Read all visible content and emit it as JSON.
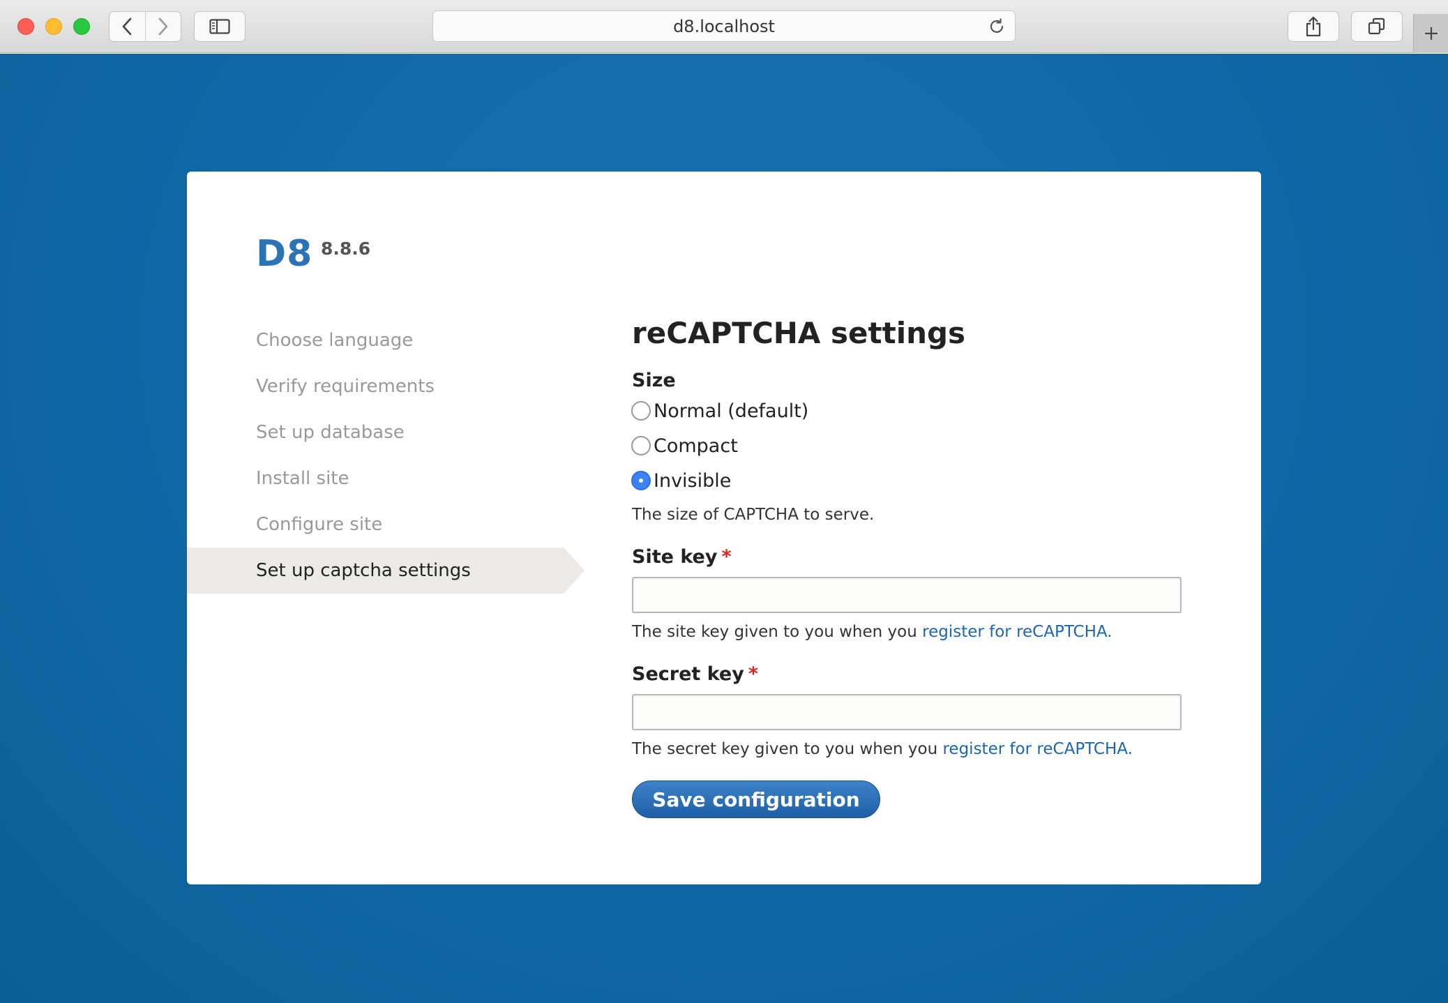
{
  "browser": {
    "url": "d8.localhost",
    "icons": [
      "back-icon",
      "forward-icon",
      "sidebar-icon",
      "reload-icon",
      "share-icon",
      "tabs-icon",
      "plus-icon"
    ]
  },
  "site": {
    "name": "D8",
    "version": "8.8.6"
  },
  "steps": [
    {
      "label": "Choose language",
      "active": false
    },
    {
      "label": "Verify requirements",
      "active": false
    },
    {
      "label": "Set up database",
      "active": false
    },
    {
      "label": "Install site",
      "active": false
    },
    {
      "label": "Configure site",
      "active": false
    },
    {
      "label": "Set up captcha settings",
      "active": true
    }
  ],
  "form": {
    "title": "reCAPTCHA settings",
    "size": {
      "label": "Size",
      "options": [
        {
          "label": "Normal (default)",
          "checked": false
        },
        {
          "label": "Compact",
          "checked": false
        },
        {
          "label": "Invisible",
          "checked": true
        }
      ],
      "description": "The size of CAPTCHA to serve."
    },
    "site_key": {
      "label": "Site key",
      "required_mark": "*",
      "value": "",
      "description_prefix": "The site key given to you when you ",
      "link_text": "register for reCAPTCHA",
      "description_suffix": "."
    },
    "secret_key": {
      "label": "Secret key",
      "required_mark": "*",
      "value": "",
      "description_prefix": "The secret key given to you when you ",
      "link_text": "register for reCAPTCHA",
      "description_suffix": "."
    },
    "submit_label": "Save configuration"
  },
  "colors": {
    "background": "#1169a8",
    "brand": "#2a74b5",
    "link": "#1c66b0",
    "required": "#d8261e",
    "button": "#2468ae"
  }
}
